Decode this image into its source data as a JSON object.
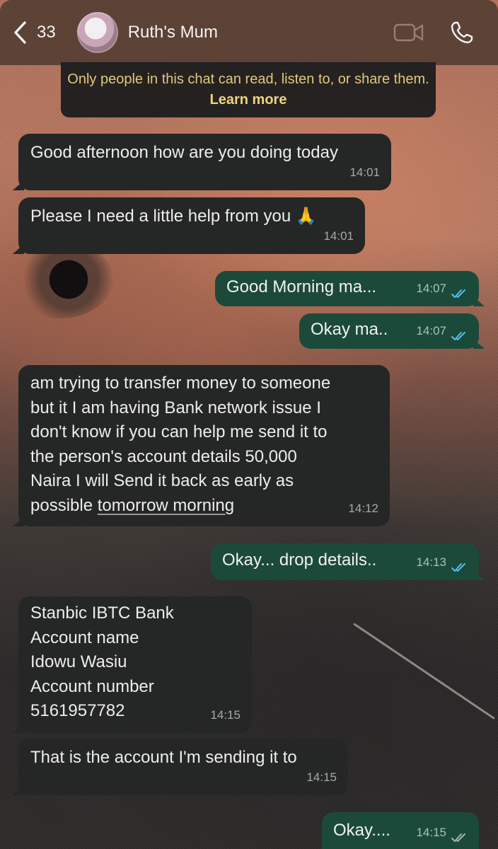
{
  "header": {
    "back_count": "33",
    "contact_name": "Ruth's Mum"
  },
  "notice": {
    "text": "Only people in this chat can read, listen to, or share them.",
    "learn_more": "Learn more"
  },
  "messages": [
    {
      "dir": "in",
      "text": "Good afternoon how are you doing today",
      "time": "14:01"
    },
    {
      "dir": "in",
      "text": "Please I need a little help from you 🙏",
      "time": "14:01"
    },
    {
      "dir": "out",
      "text": "Good Morning ma...",
      "time": "14:07",
      "status": "read"
    },
    {
      "dir": "out",
      "text": "Okay ma..",
      "time": "14:07",
      "status": "read"
    },
    {
      "dir": "in",
      "lines": [
        "am trying to transfer money to someone",
        "but it I am having Bank  network issue  I",
        "don't know if you can help me send it to",
        "the person's account details 50,000",
        "Naira I will Send it back as early as"
      ],
      "last_line_plain": "possible ",
      "last_line_link": "tomorrow morning",
      "time": "14:12"
    },
    {
      "dir": "out",
      "text": "Okay... drop details..",
      "time": "14:13",
      "status": "read"
    },
    {
      "dir": "in",
      "lines": [
        "Stanbic IBTC Bank",
        "Account name",
        "Idowu Wasiu",
        "Account number",
        "5161957782"
      ],
      "time": "14:15"
    },
    {
      "dir": "in",
      "text": "That is the account I'm sending it to",
      "time": "14:15"
    },
    {
      "dir": "out",
      "text": "Okay....",
      "time": "14:15",
      "status": "read"
    }
  ],
  "colors": {
    "incoming_bubble": "#252626",
    "outgoing_bubble": "#1c4a3a",
    "read_ticks": "#53bdeb",
    "notice_text": "#e3c77a"
  }
}
